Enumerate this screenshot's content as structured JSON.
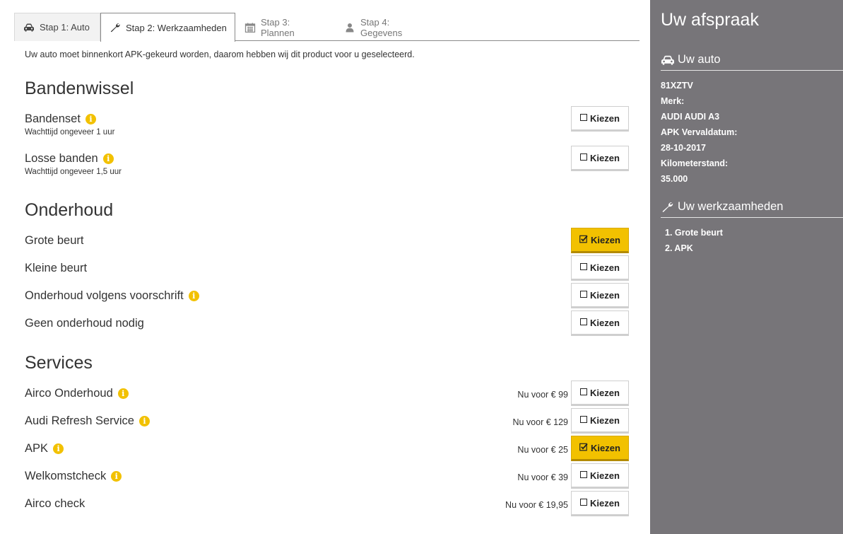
{
  "tabs": [
    {
      "label": "Stap 1: Auto",
      "icon": "car-icon"
    },
    {
      "label": "Stap 2: Werkzaamheden",
      "icon": "wrench-icon"
    },
    {
      "label": "Stap 3: Plannen",
      "icon": "calendar-icon"
    },
    {
      "label": "Stap 4: Gegevens",
      "icon": "user-icon"
    }
  ],
  "intro": "Uw auto moet binnenkort APK-gekeurd worden, daarom hebben wij dit product voor u geselecteerd.",
  "button_label": "Kiezen",
  "accent_color": "#f2c100",
  "sections": {
    "bandenwissel": {
      "title": "Bandenwissel",
      "items": [
        {
          "label": "Bandenset",
          "sub": "Wachttijd ongeveer 1 uur",
          "info": true,
          "selected": false
        },
        {
          "label": "Losse banden",
          "sub": "Wachttijd ongeveer 1,5 uur",
          "info": true,
          "selected": false
        }
      ]
    },
    "onderhoud": {
      "title": "Onderhoud",
      "items": [
        {
          "label": "Grote beurt",
          "info": false,
          "selected": true
        },
        {
          "label": "Kleine beurt",
          "info": false,
          "selected": false
        },
        {
          "label": "Onderhoud volgens voorschrift",
          "info": true,
          "selected": false
        },
        {
          "label": "Geen onderhoud nodig",
          "info": false,
          "selected": false
        }
      ]
    },
    "services": {
      "title": "Services",
      "items": [
        {
          "label": "Airco Onderhoud",
          "price": "Nu voor € 99",
          "info": true,
          "selected": false
        },
        {
          "label": "Audi Refresh Service",
          "price": "Nu voor € 129",
          "info": true,
          "selected": false
        },
        {
          "label": "APK",
          "price": "Nu voor € 25",
          "info": true,
          "selected": true
        },
        {
          "label": "Welkomstcheck",
          "price": "Nu voor € 39",
          "info": true,
          "selected": false
        },
        {
          "label": "Airco check",
          "price": "Nu voor € 19,95",
          "info": false,
          "selected": false
        }
      ]
    }
  },
  "sidebar": {
    "title": "Uw afspraak",
    "car_heading": "Uw auto",
    "plate": "81XZTV",
    "merk_label": "Merk:",
    "merk_value": "AUDI AUDI A3",
    "apk_label": "APK Vervaldatum:",
    "apk_value": "28-10-2017",
    "km_label": "Kilometerstand:",
    "km_value": "35.000",
    "work_heading": "Uw werkzaamheden",
    "work_items": [
      "1. Grote beurt",
      "2. APK"
    ],
    "background_color": "#777579"
  }
}
